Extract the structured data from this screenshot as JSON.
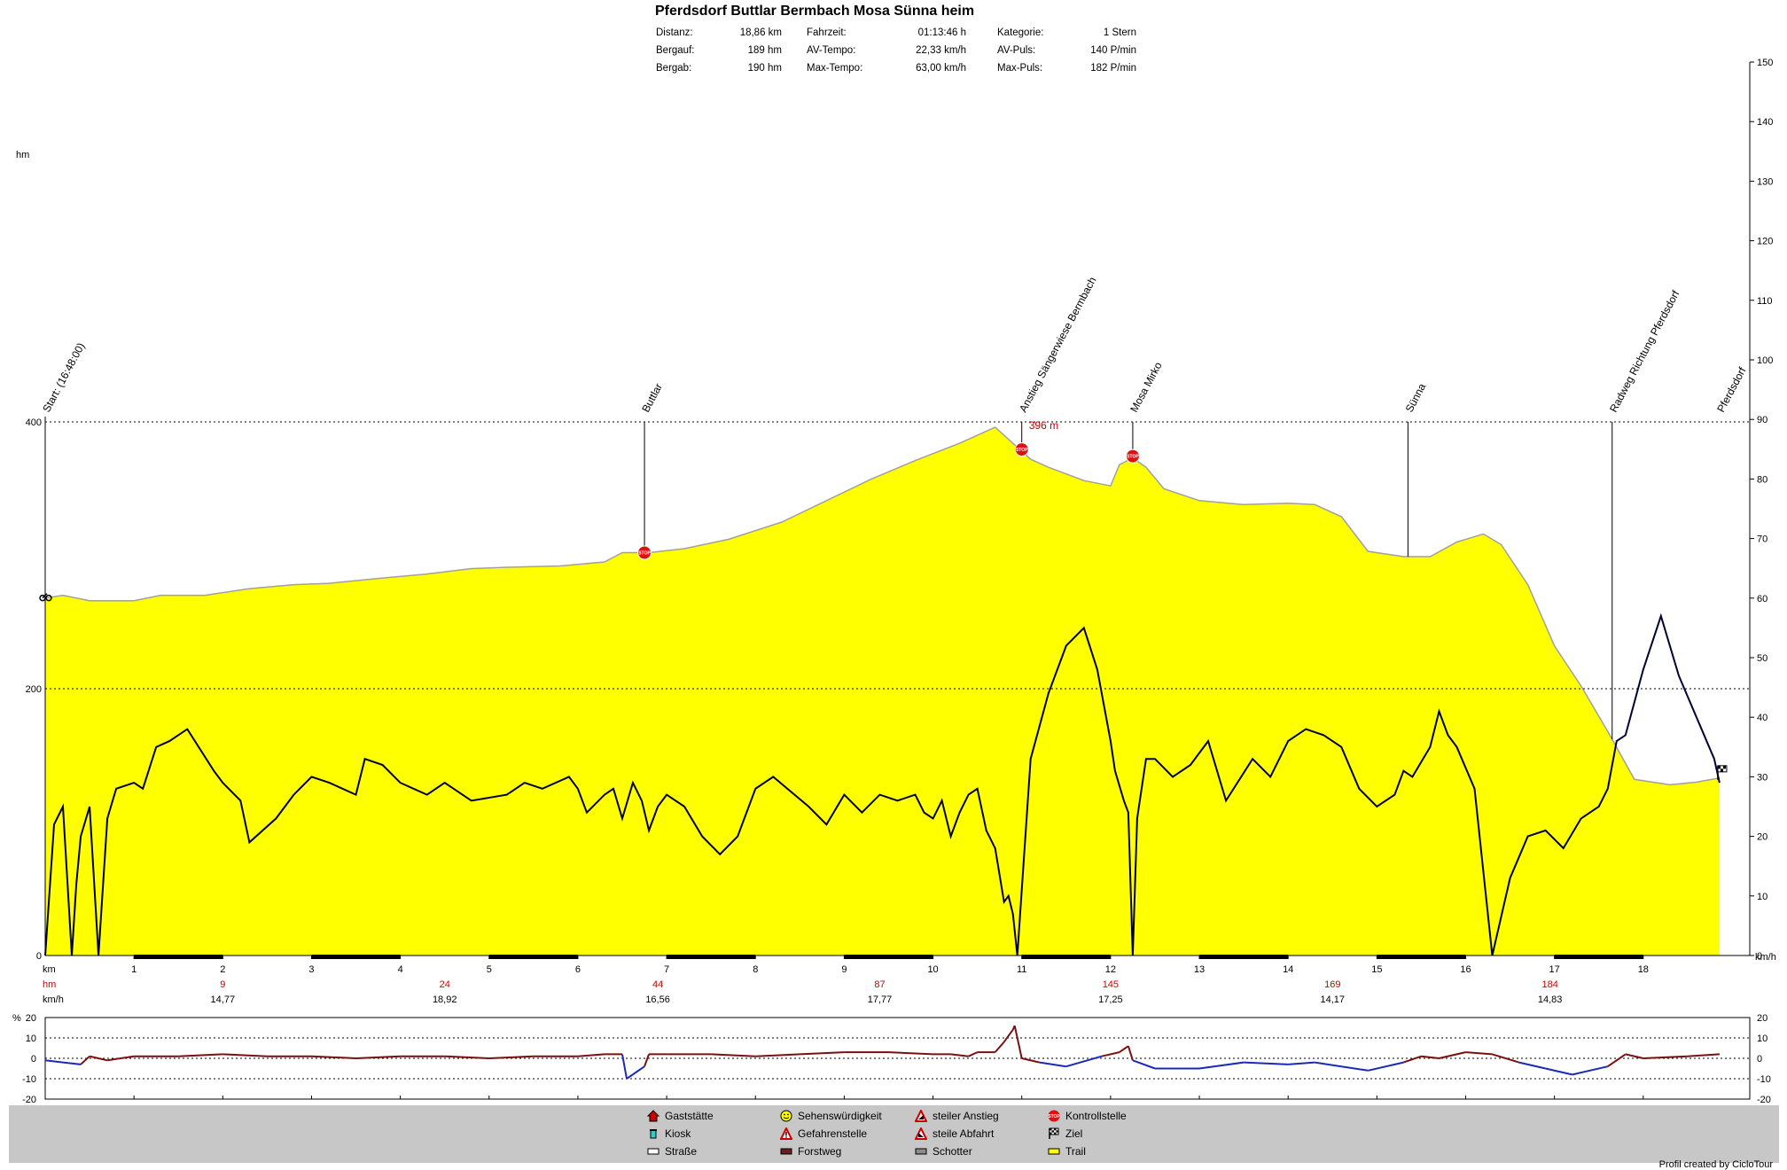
{
  "header": {
    "title": "Pferdsdorf Buttlar Bermbach Mosa Sünna heim",
    "stats": [
      [
        {
          "label": "Distanz:",
          "value": "18,86 km"
        },
        {
          "label": "Fahrzeit:",
          "value": "01:13:46 h"
        },
        {
          "label": "Kategorie:",
          "value": "1 Stern"
        }
      ],
      [
        {
          "label": "Bergauf:",
          "value": "189 hm"
        },
        {
          "label": "AV-Tempo:",
          "value": "22,33 km/h"
        },
        {
          "label": "AV-Puls:",
          "value": "140 P/min"
        }
      ],
      [
        {
          "label": "Bergab:",
          "value": "190 hm"
        },
        {
          "label": "Max-Tempo:",
          "value": "63,00 km/h"
        },
        {
          "label": "Max-Puls:",
          "value": "182 P/min"
        }
      ]
    ]
  },
  "chart_data": {
    "type": "area",
    "x_label": "km",
    "y_left_label": "hm",
    "y_right_label": "km/h",
    "x_range": [
      0,
      19.2
    ],
    "y_left_range": [
      0,
      400
    ],
    "y_left_ticks": [
      "0",
      "200",
      "400"
    ],
    "y_right_range": [
      0,
      150
    ],
    "y_right_ticks": [
      "0",
      "10",
      "20",
      "30",
      "40",
      "50",
      "60",
      "70",
      "80",
      "90",
      "100",
      "110",
      "120",
      "130",
      "140",
      "150"
    ],
    "x_ticks": [
      "1",
      "2",
      "3",
      "4",
      "5",
      "6",
      "7",
      "8",
      "9",
      "10",
      "11",
      "12",
      "13",
      "14",
      "15",
      "16",
      "17",
      "18"
    ],
    "max_altitude_label": "396 m",
    "elevation": {
      "name": "Höhe",
      "x": [
        0,
        0.2,
        0.5,
        1.0,
        1.3,
        1.8,
        2.3,
        2.8,
        3.2,
        3.8,
        4.3,
        4.8,
        5.2,
        5.8,
        6.3,
        6.5,
        6.8,
        7.2,
        7.7,
        8.3,
        8.8,
        9.3,
        9.8,
        10.3,
        10.7,
        10.9,
        11.1,
        11.3,
        11.7,
        12.0,
        12.1,
        12.25,
        12.4,
        12.6,
        13.0,
        13.5,
        14.0,
        14.3,
        14.6,
        14.9,
        15.3,
        15.6,
        15.9,
        16.2,
        16.4,
        16.7,
        17.0,
        17.3,
        17.6,
        17.9,
        18.3,
        18.6,
        18.86
      ],
      "y": [
        268,
        270,
        266,
        266,
        270,
        270,
        275,
        278,
        279,
        283,
        286,
        290,
        291,
        292,
        295,
        302,
        302,
        305,
        312,
        325,
        341,
        357,
        371,
        384,
        396,
        384,
        372,
        366,
        356,
        352,
        368,
        373,
        366,
        350,
        341,
        338,
        339,
        338,
        329,
        303,
        299,
        299,
        310,
        316,
        308,
        278,
        232,
        202,
        168,
        132,
        128,
        130,
        133
      ]
    },
    "speed": {
      "name": "Geschwindigkeit",
      "x": [
        0,
        0.1,
        0.2,
        0.3,
        0.35,
        0.4,
        0.5,
        0.6,
        0.7,
        0.8,
        1.0,
        1.1,
        1.25,
        1.4,
        1.6,
        1.9,
        2.0,
        2.2,
        2.3,
        2.6,
        2.8,
        3.0,
        3.2,
        3.5,
        3.6,
        3.8,
        4.0,
        4.3,
        4.5,
        4.8,
        5.2,
        5.4,
        5.6,
        5.9,
        6.0,
        6.1,
        6.3,
        6.4,
        6.5,
        6.62,
        6.72,
        6.8,
        6.9,
        7.0,
        7.2,
        7.4,
        7.6,
        7.8,
        8.0,
        8.2,
        8.6,
        8.8,
        9.0,
        9.2,
        9.4,
        9.6,
        9.8,
        9.9,
        10.0,
        10.1,
        10.2,
        10.3,
        10.4,
        10.5,
        10.6,
        10.7,
        10.8,
        10.85,
        10.9,
        10.95,
        11.0,
        11.1,
        11.3,
        11.5,
        11.7,
        11.85,
        12.0,
        12.05,
        12.15,
        12.2,
        12.25,
        12.3,
        12.4,
        12.5,
        12.7,
        12.9,
        13.1,
        13.3,
        13.6,
        13.8,
        14.0,
        14.2,
        14.4,
        14.6,
        14.8,
        15.0,
        15.2,
        15.3,
        15.4,
        15.6,
        15.7,
        15.8,
        15.9,
        16.1,
        16.3,
        16.5,
        16.7,
        16.9,
        17.1,
        17.3,
        17.5,
        17.6,
        17.7,
        17.8,
        18.0,
        18.2,
        18.4,
        18.6,
        18.8,
        18.86
      ],
      "y": [
        0,
        22,
        25,
        0,
        12,
        20,
        25,
        0,
        23,
        28,
        29,
        28,
        35,
        36,
        38,
        31,
        29,
        26,
        19,
        23,
        27,
        30,
        29,
        27,
        33,
        32,
        29,
        27,
        29,
        26,
        27,
        29,
        28,
        30,
        28,
        24,
        27,
        28,
        23,
        29,
        26,
        21,
        25,
        27,
        25,
        20,
        17,
        20,
        28,
        30,
        25,
        22,
        27,
        24,
        27,
        26,
        27,
        24,
        23,
        26,
        20,
        24,
        27,
        28,
        21,
        18,
        9,
        10,
        7,
        0,
        11,
        33,
        44,
        52,
        55,
        48,
        36,
        31,
        26,
        24,
        0,
        23,
        33,
        33,
        30,
        32,
        36,
        26,
        33,
        30,
        36,
        38,
        37,
        35,
        28,
        25,
        27,
        31,
        30,
        35,
        41,
        37,
        35,
        28,
        0,
        13,
        20,
        21,
        18,
        23,
        25,
        28,
        36,
        37,
        48,
        57,
        47,
        40,
        33,
        29,
        31,
        33,
        34,
        32,
        22,
        1,
        20
      ]
    },
    "poi_markers": [
      {
        "x": 0.0,
        "label": "Start: (16:48:00)"
      },
      {
        "x": 6.75,
        "label": "Buttlar"
      },
      {
        "x": 11.0,
        "label": "Anstieg Sängerwiese Bermbach"
      },
      {
        "x": 12.25,
        "label": "Mosa Mirko"
      },
      {
        "x": 15.35,
        "label": "Sünna"
      },
      {
        "x": 17.65,
        "label": "Radweg Richtung Pferdsdorf"
      },
      {
        "x": 18.86,
        "label": "Pferdsdorf"
      }
    ],
    "segment_table": {
      "row_labels": [
        "km",
        "hm",
        "km/h"
      ],
      "hm": [
        {
          "x": 2.0,
          "value": "9"
        },
        {
          "x": 4.5,
          "value": "24"
        },
        {
          "x": 6.9,
          "value": "44"
        },
        {
          "x": 9.4,
          "value": "87"
        },
        {
          "x": 12.0,
          "value": "145"
        },
        {
          "x": 14.5,
          "value": "169"
        },
        {
          "x": 16.95,
          "value": "184"
        }
      ],
      "kmh": [
        {
          "x": 2.0,
          "value": "14,77"
        },
        {
          "x": 4.5,
          "value": "18,92"
        },
        {
          "x": 6.9,
          "value": "16,56"
        },
        {
          "x": 9.4,
          "value": "17,77"
        },
        {
          "x": 12.0,
          "value": "17,25"
        },
        {
          "x": 14.5,
          "value": "14,17"
        },
        {
          "x": 16.95,
          "value": "14,83"
        }
      ]
    },
    "gradient": {
      "y_label": "% 20",
      "y_range": [
        -20,
        20
      ],
      "y_ticks": [
        "20",
        "10",
        "0",
        "-10",
        "-20"
      ],
      "x": [
        0,
        0.2,
        0.4,
        0.5,
        0.6,
        0.7,
        1.0,
        1.5,
        2.0,
        2.5,
        3.0,
        3.5,
        4.0,
        4.5,
        5.0,
        5.5,
        6.0,
        6.3,
        6.5,
        6.55,
        6.75,
        6.8,
        7.0,
        7.5,
        8.0,
        8.5,
        9.0,
        9.5,
        10.0,
        10.2,
        10.4,
        10.5,
        10.7,
        10.8,
        10.9,
        10.92,
        11.0,
        11.2,
        11.5,
        11.9,
        12.1,
        12.2,
        12.25,
        12.5,
        13.0,
        13.5,
        14.0,
        14.3,
        14.6,
        14.9,
        15.3,
        15.5,
        15.7,
        16.0,
        16.3,
        16.6,
        16.9,
        17.2,
        17.6,
        17.8,
        18.0,
        18.5,
        18.86
      ],
      "y": [
        -1,
        -2,
        -3,
        1,
        0,
        -1,
        1,
        1,
        2,
        1,
        1,
        0,
        1,
        1,
        0,
        1,
        1,
        2,
        2,
        -10,
        -4,
        2,
        2,
        2,
        1,
        2,
        3,
        3,
        2,
        2,
        1,
        3,
        3,
        8,
        14,
        16,
        0,
        -2,
        -4,
        1,
        3,
        6,
        -1,
        -5,
        -5,
        -2,
        -3,
        -2,
        -4,
        -6,
        -2,
        1,
        0,
        3,
        2,
        -2,
        -5,
        -8,
        -4,
        2,
        0,
        1,
        2
      ]
    },
    "legend": [
      {
        "icon": "house-icon",
        "label": "Gaststätte"
      },
      {
        "icon": "smiley-icon",
        "label": "Sehenswürdigkeit"
      },
      {
        "icon": "steep-climb-icon",
        "label": "steiler Anstieg"
      },
      {
        "icon": "stop-icon",
        "label": "Kontrollstelle"
      },
      {
        "icon": "cup-icon",
        "label": "Kiosk"
      },
      {
        "icon": "warning-icon",
        "label": "Gefahrenstelle"
      },
      {
        "icon": "steep-descent-icon",
        "label": "steile Abfahrt"
      },
      {
        "icon": "flag-icon",
        "label": "Ziel"
      },
      {
        "icon": "road-swatch",
        "label": "Straße",
        "color": "#ffffff"
      },
      {
        "icon": "forest-swatch",
        "label": "Forstweg",
        "color": "#6b1f1f"
      },
      {
        "icon": "gravel-swatch",
        "label": "Schotter",
        "color": "#8c8c8c"
      },
      {
        "icon": "trail-swatch",
        "label": "Trail",
        "color": "#ffff00"
      }
    ],
    "colors": {
      "fill": "#ffff00",
      "profile": "#a0a0a0",
      "speed": "#000033",
      "stop": "#dd1111",
      "gradient_up": "#7a1010",
      "gradient_down": "#1a2ab8",
      "poi_label": "#cc0000"
    }
  },
  "footer": {
    "credit": "Profil created by CicloTour"
  }
}
